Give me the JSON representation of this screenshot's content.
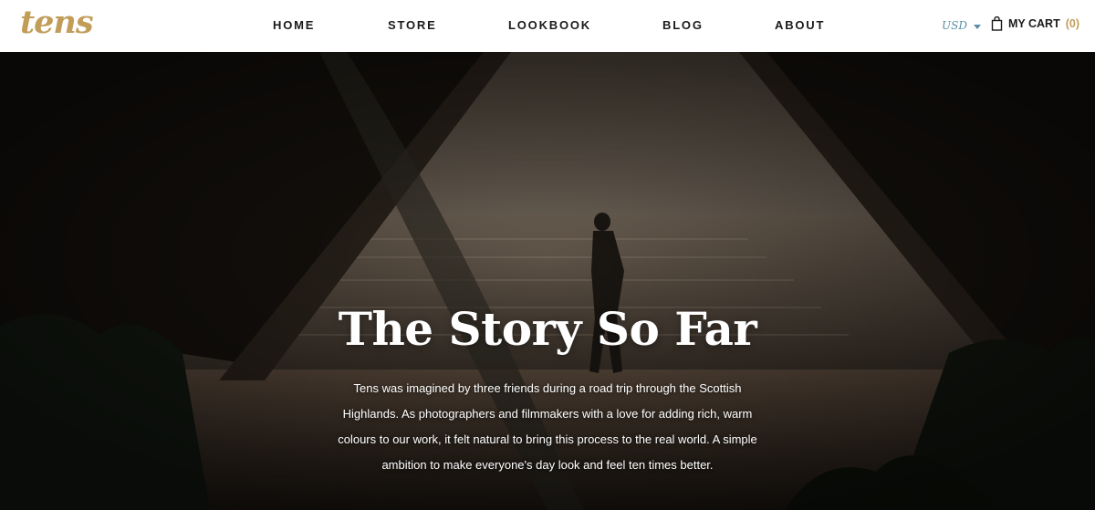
{
  "brand": {
    "logo_text": "tens",
    "accent_color": "#c29d5a"
  },
  "nav": {
    "items": [
      {
        "label": "HOME"
      },
      {
        "label": "STORE"
      },
      {
        "label": "LOOKBOOK"
      },
      {
        "label": "BLOG"
      },
      {
        "label": "ABOUT"
      }
    ]
  },
  "currency": {
    "selected": "USD",
    "icon": "chevron-down-icon",
    "color": "#5b8ea8"
  },
  "cart": {
    "icon": "shopping-bag-icon",
    "label": "MY CART",
    "count": "(0)"
  },
  "hero": {
    "title": "The Story So Far",
    "body": "Tens was imagined by three friends during a road trip through the Scottish Highlands. As photographers and filmmakers with a love for adding rich, warm colours to our work, it felt natural to bring this process to the real world. A simple ambition to make everyone's day look and feel ten times better."
  }
}
